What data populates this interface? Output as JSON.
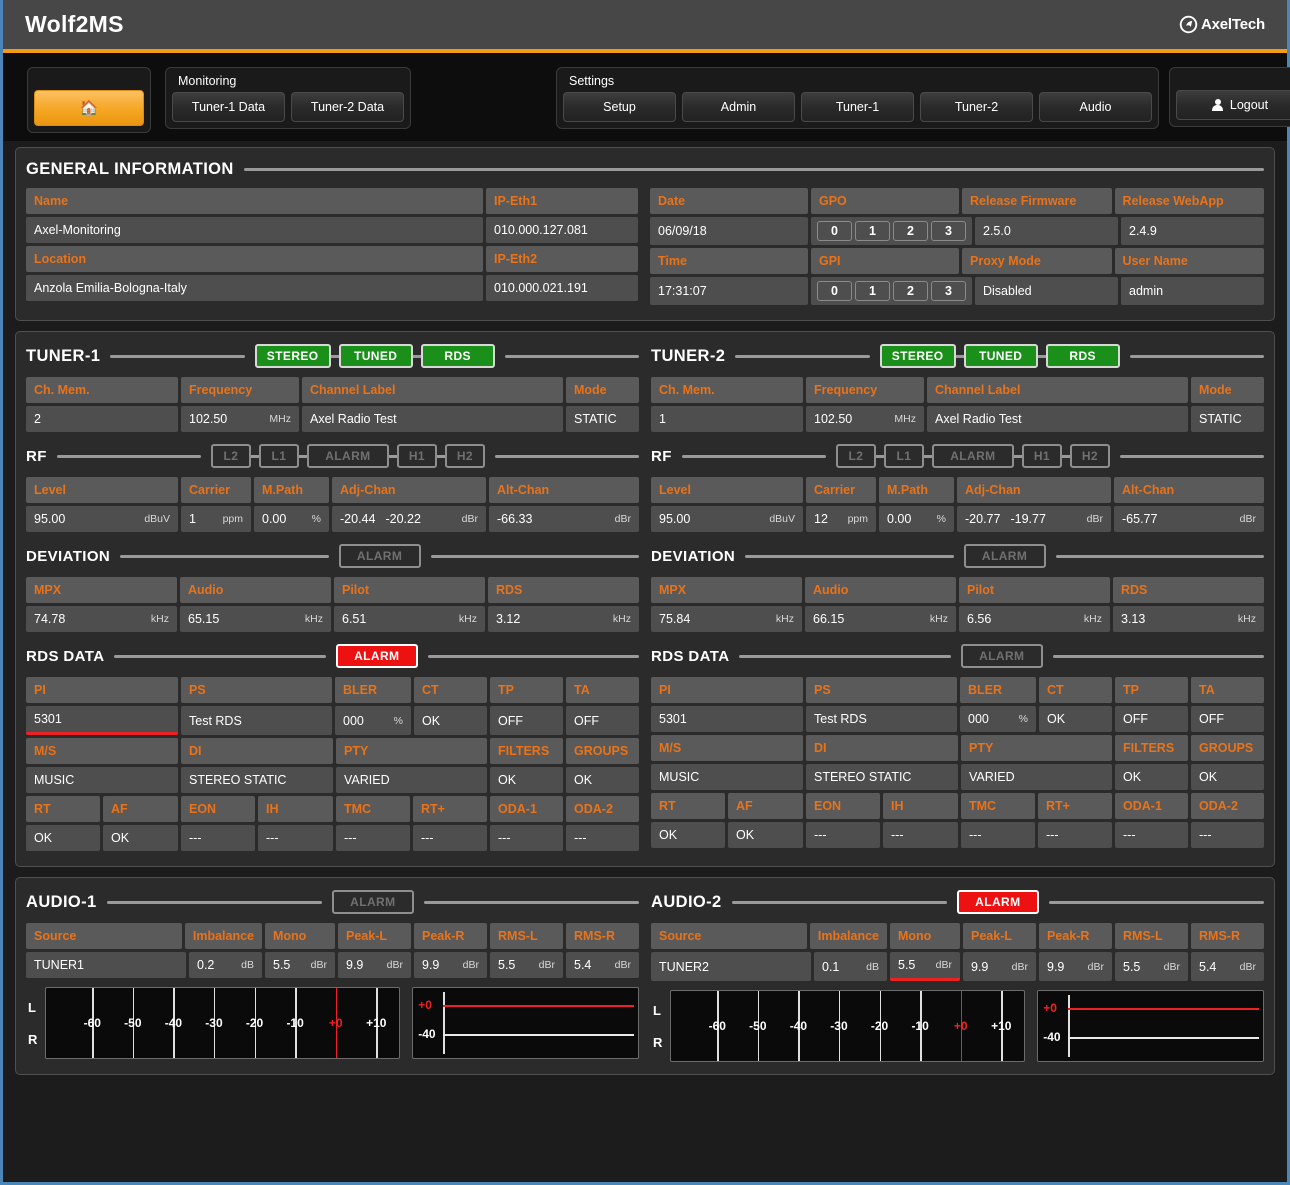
{
  "titlebar": {
    "app_title": "Wolf2MS",
    "brand": "AxelTech",
    "brand_icon": "axeltech-logo-icon"
  },
  "nav": {
    "home_icon": "home-icon",
    "monitoring": {
      "label": "Monitoring",
      "buttons": [
        "Tuner-1 Data",
        "Tuner-2 Data"
      ]
    },
    "settings": {
      "label": "Settings",
      "buttons": [
        "Setup",
        "Admin",
        "Tuner-1",
        "Tuner-2",
        "Audio"
      ]
    },
    "logout": {
      "label": "Logout",
      "icon": "user-icon"
    }
  },
  "general": {
    "title": "GENERAL INFORMATION",
    "name_hdr": "Name",
    "name_val": "Axel-Monitoring",
    "ip1_hdr": "IP-Eth1",
    "ip1_val": "010.000.127.081",
    "location_hdr": "Location",
    "location_val": "Anzola Emilia-Bologna-Italy",
    "ip2_hdr": "IP-Eth2",
    "ip2_val": "010.000.021.191",
    "date_hdr": "Date",
    "date_val": "06/09/18",
    "gpo_hdr": "GPO",
    "gpo_pins": [
      "0",
      "1",
      "2",
      "3"
    ],
    "fw_hdr": "Release Firmware",
    "fw_val": "2.5.0",
    "webapp_hdr": "Release WebApp",
    "webapp_val": "2.4.9",
    "time_hdr": "Time",
    "time_val": "17:31:07",
    "gpi_hdr": "GPI",
    "gpi_pins": [
      "0",
      "1",
      "2",
      "3"
    ],
    "proxy_hdr": "Proxy Mode",
    "proxy_val": "Disabled",
    "user_hdr": "User Name",
    "user_val": "admin"
  },
  "tuner1": {
    "title": "TUNER-1",
    "status": [
      {
        "label": "STEREO",
        "state": "green"
      },
      {
        "label": "TUNED",
        "state": "green"
      },
      {
        "label": "RDS",
        "state": "green"
      }
    ],
    "ch_hdr": "Ch. Mem.",
    "ch_val": "2",
    "freq_hdr": "Frequency",
    "freq_val": "102.50",
    "freq_unit": "MHz",
    "label_hdr": "Channel Label",
    "label_val": "Axel Radio Test",
    "mode_hdr": "Mode",
    "mode_val": "STATIC",
    "rf": {
      "title": "RF",
      "badges": [
        {
          "label": "L2",
          "state": "off"
        },
        {
          "label": "L1",
          "state": "off"
        },
        {
          "label": "ALARM",
          "state": "off"
        },
        {
          "label": "H1",
          "state": "off"
        },
        {
          "label": "H2",
          "state": "off"
        }
      ],
      "level_hdr": "Level",
      "level_val": "95.00",
      "level_unit": "dBuV",
      "carrier_hdr": "Carrier",
      "carrier_val": "1",
      "carrier_unit": "ppm",
      "mpath_hdr": "M.Path",
      "mpath_val": "0.00",
      "mpath_unit": "%",
      "adj_hdr": "Adj-Chan",
      "adj_val1": "-20.44",
      "adj_val2": "-20.22",
      "adj_unit": "dBr",
      "alt_hdr": "Alt-Chan",
      "alt_val": "-66.33",
      "alt_unit": "dBr"
    },
    "deviation": {
      "title": "DEVIATION",
      "badges": [
        {
          "label": "ALARM",
          "state": "off"
        }
      ],
      "mpx_hdr": "MPX",
      "mpx_val": "74.78",
      "mpx_unit": "kHz",
      "audio_hdr": "Audio",
      "audio_val": "65.15",
      "audio_unit": "kHz",
      "pilot_hdr": "Pilot",
      "pilot_val": "6.51",
      "pilot_unit": "kHz",
      "rds_hdr": "RDS",
      "rds_val": "3.12",
      "rds_unit": "kHz"
    },
    "rds": {
      "title": "RDS DATA",
      "badges": [
        {
          "label": "ALARM",
          "state": "red"
        }
      ],
      "pi_hdr": "PI",
      "pi_val": "5301",
      "pi_alarm": true,
      "ps_hdr": "PS",
      "ps_val": "Test RDS",
      "bler_hdr": "BLER",
      "bler_val": "000",
      "bler_unit": "%",
      "ct_hdr": "CT",
      "ct_val": "OK",
      "tp_hdr": "TP",
      "tp_val": "OFF",
      "ta_hdr": "TA",
      "ta_val": "OFF",
      "ms_hdr": "M/S",
      "ms_val": "MUSIC",
      "di_hdr": "DI",
      "di_val": "STEREO STATIC",
      "pty_hdr": "PTY",
      "pty_val": "VARIED",
      "filters_hdr": "FILTERS",
      "filters_val": "OK",
      "groups_hdr": "GROUPS",
      "groups_val": "OK",
      "rt_hdr": "RT",
      "rt_val": "OK",
      "af_hdr": "AF",
      "af_val": "OK",
      "eon_hdr": "EON",
      "eon_val": "---",
      "ih_hdr": "IH",
      "ih_val": "---",
      "tmc_hdr": "TMC",
      "tmc_val": "---",
      "rtplus_hdr": "RT+",
      "rtplus_val": "---",
      "oda1_hdr": "ODA-1",
      "oda1_val": "---",
      "oda2_hdr": "ODA-2",
      "oda2_val": "---"
    }
  },
  "tuner2": {
    "title": "TUNER-2",
    "status": [
      {
        "label": "STEREO",
        "state": "green"
      },
      {
        "label": "TUNED",
        "state": "green"
      },
      {
        "label": "RDS",
        "state": "green"
      }
    ],
    "ch_hdr": "Ch. Mem.",
    "ch_val": "1",
    "freq_hdr": "Frequency",
    "freq_val": "102.50",
    "freq_unit": "MHz",
    "label_hdr": "Channel Label",
    "label_val": "Axel Radio Test",
    "mode_hdr": "Mode",
    "mode_val": "STATIC",
    "rf": {
      "title": "RF",
      "badges": [
        {
          "label": "L2",
          "state": "off"
        },
        {
          "label": "L1",
          "state": "off"
        },
        {
          "label": "ALARM",
          "state": "off"
        },
        {
          "label": "H1",
          "state": "off"
        },
        {
          "label": "H2",
          "state": "off"
        }
      ],
      "level_hdr": "Level",
      "level_val": "95.00",
      "level_unit": "dBuV",
      "carrier_hdr": "Carrier",
      "carrier_val": "12",
      "carrier_unit": "ppm",
      "mpath_hdr": "M.Path",
      "mpath_val": "0.00",
      "mpath_unit": "%",
      "adj_hdr": "Adj-Chan",
      "adj_val1": "-20.77",
      "adj_val2": "-19.77",
      "adj_unit": "dBr",
      "alt_hdr": "Alt-Chan",
      "alt_val": "-65.77",
      "alt_unit": "dBr"
    },
    "deviation": {
      "title": "DEVIATION",
      "badges": [
        {
          "label": "ALARM",
          "state": "off"
        }
      ],
      "mpx_hdr": "MPX",
      "mpx_val": "75.84",
      "mpx_unit": "kHz",
      "audio_hdr": "Audio",
      "audio_val": "66.15",
      "audio_unit": "kHz",
      "pilot_hdr": "Pilot",
      "pilot_val": "6.56",
      "pilot_unit": "kHz",
      "rds_hdr": "RDS",
      "rds_val": "3.13",
      "rds_unit": "kHz"
    },
    "rds": {
      "title": "RDS DATA",
      "badges": [
        {
          "label": "ALARM",
          "state": "off"
        }
      ],
      "pi_hdr": "PI",
      "pi_val": "5301",
      "pi_alarm": false,
      "ps_hdr": "PS",
      "ps_val": "Test RDS",
      "bler_hdr": "BLER",
      "bler_val": "000",
      "bler_unit": "%",
      "ct_hdr": "CT",
      "ct_val": "OK",
      "tp_hdr": "TP",
      "tp_val": "OFF",
      "ta_hdr": "TA",
      "ta_val": "OFF",
      "ms_hdr": "M/S",
      "ms_val": "MUSIC",
      "di_hdr": "DI",
      "di_val": "STEREO STATIC",
      "pty_hdr": "PTY",
      "pty_val": "VARIED",
      "filters_hdr": "FILTERS",
      "filters_val": "OK",
      "groups_hdr": "GROUPS",
      "groups_val": "OK",
      "rt_hdr": "RT",
      "rt_val": "OK",
      "af_hdr": "AF",
      "af_val": "OK",
      "eon_hdr": "EON",
      "eon_val": "---",
      "ih_hdr": "IH",
      "ih_val": "---",
      "tmc_hdr": "TMC",
      "tmc_val": "---",
      "rtplus_hdr": "RT+",
      "rtplus_val": "---",
      "oda1_hdr": "ODA-1",
      "oda1_val": "---",
      "oda2_hdr": "ODA-2",
      "oda2_val": "---"
    }
  },
  "audio1": {
    "title": "AUDIO-1",
    "badges": [
      {
        "label": "ALARM",
        "state": "off"
      }
    ],
    "source_hdr": "Source",
    "source_val": "TUNER1",
    "imbalance_hdr": "Imbalance",
    "imbalance_val": "0.2",
    "imbalance_unit": "dB",
    "mono_hdr": "Mono",
    "mono_val": "5.5",
    "mono_unit": "dBr",
    "mono_alarm": false,
    "peakl_hdr": "Peak-L",
    "peakl_val": "9.9",
    "peakl_unit": "dBr",
    "peakr_hdr": "Peak-R",
    "peakr_val": "9.9",
    "peakr_unit": "dBr",
    "rmsl_hdr": "RMS-L",
    "rmsl_val": "5.5",
    "rmsl_unit": "dBr",
    "rmsr_hdr": "RMS-R",
    "rmsr_val": "5.4",
    "rmsr_unit": "dBr",
    "meter": {
      "left_label": "L",
      "right_label": "R",
      "ticks": [
        "-60",
        "-50",
        "-40",
        "-30",
        "-20",
        "-10",
        "+0",
        "+10"
      ],
      "side_top_label": "+0",
      "side_bottom_label": "-40"
    }
  },
  "audio2": {
    "title": "AUDIO-2",
    "badges": [
      {
        "label": "ALARM",
        "state": "red"
      }
    ],
    "source_hdr": "Source",
    "source_val": "TUNER2",
    "imbalance_hdr": "Imbalance",
    "imbalance_val": "0.1",
    "imbalance_unit": "dB",
    "mono_hdr": "Mono",
    "mono_val": "5.5",
    "mono_unit": "dBr",
    "mono_alarm": true,
    "peakl_hdr": "Peak-L",
    "peakl_val": "9.9",
    "peakl_unit": "dBr",
    "peakr_hdr": "Peak-R",
    "peakr_val": "9.9",
    "peakr_unit": "dBr",
    "rmsl_hdr": "RMS-L",
    "rmsl_val": "5.5",
    "rmsl_unit": "dBr",
    "rmsr_hdr": "RMS-R",
    "rmsr_val": "5.4",
    "rmsr_unit": "dBr",
    "meter": {
      "left_label": "L",
      "right_label": "R",
      "ticks": [
        "-60",
        "-50",
        "-40",
        "-30",
        "-20",
        "-10",
        "+0",
        "+10"
      ],
      "side_top_label": "+0",
      "side_bottom_label": "-40"
    }
  },
  "colors": {
    "accent": "#f39c12",
    "header_text": "#e8731a",
    "green": "#1a8f1a",
    "red": "#ee1111"
  }
}
